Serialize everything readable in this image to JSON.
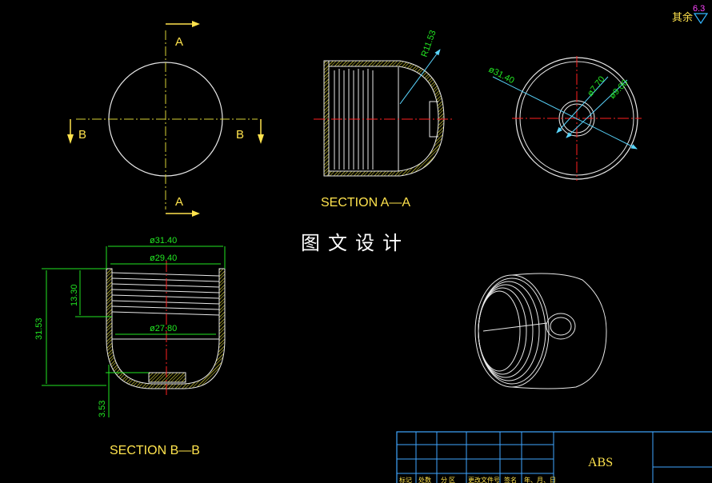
{
  "title_text": "图 文 设 计",
  "roughness": {
    "label": "其余",
    "value": "6.3"
  },
  "top_view": {
    "section_letter_a": "A",
    "section_letter_b": "B"
  },
  "section_aa": {
    "caption": "SECTION A—A",
    "radius_dim": "R11.53"
  },
  "end_view": {
    "dia_outer": "ø31.40",
    "dia_small": "ø7.70",
    "dia_mid": "ø9.00"
  },
  "section_bb": {
    "caption": "SECTION B—B",
    "dia_outer": "ø31.40",
    "dia_thread": "ø29.40",
    "dia_inner": "ø27.80",
    "height_total": "31.53",
    "height_thread": "13.30",
    "depth_bottom": "3.53"
  },
  "title_block": {
    "material": "ABS",
    "headers": [
      "标记",
      "处数",
      "分 区",
      "更改文件号",
      "签名",
      "年、月、日"
    ]
  },
  "colors": {
    "outline": "#ffffff",
    "hatch": "#d9d236",
    "dimension": "#22e622",
    "section_label": "#ffe34d",
    "center_line": "#ff2020",
    "hidden": "#5ad6ff",
    "table": "#3fa6ff"
  }
}
